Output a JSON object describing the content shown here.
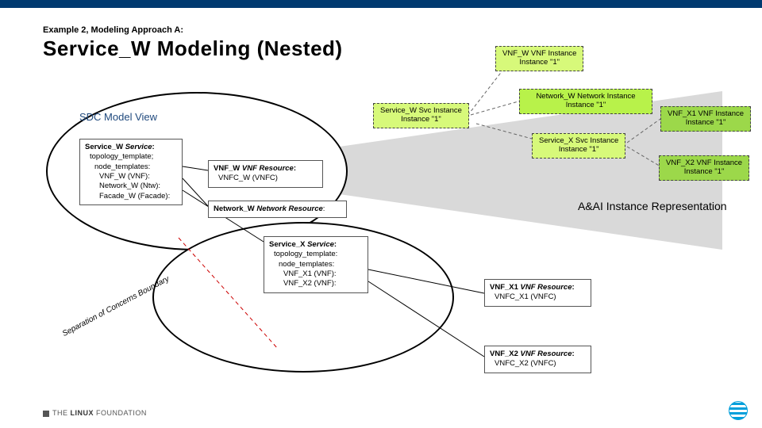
{
  "header": {
    "subtitle": "Example 2, Modeling Approach A:",
    "title": "Service_W Modeling (Nested)"
  },
  "sdc_label": "SDC Model View",
  "service_w": {
    "hdr_pre": "Service_W ",
    "hdr_ital": "Service",
    "l1": "topology_template;",
    "l2": "node_templates:",
    "l3": "VNF_W (VNF):",
    "l4": "Network_W (Ntw):",
    "l5": "Facade_W (Facade):"
  },
  "vnfw_res": {
    "pre": "VNF_W ",
    "ital": "VNF Resource",
    "l1": "VNFC_W (VNFC)"
  },
  "netw_res": {
    "pre": "Network_W ",
    "ital": "Network Resource",
    "suffix": ":"
  },
  "service_x": {
    "hdr_pre": "Service_X ",
    "hdr_ital": "Service",
    "l1": "topology_template:",
    "l2": "node_templates:",
    "l3": "VNF_X1 (VNF):",
    "l4": "VNF_X2 (VNF):"
  },
  "x1_res": {
    "pre": "VNF_X1 ",
    "ital": "VNF Resource",
    "l1": "VNFC_X1 (VNFC)"
  },
  "x2_res": {
    "pre": "VNF_X2 ",
    "ital": "VNF Resource",
    "l1": "VNFC_X2 (VNFC)"
  },
  "instances": {
    "vnfw": {
      "l1": "VNF_W VNF Instance",
      "l2": "Instance \"1\""
    },
    "svcw": {
      "l1": "Service_W Svc Instance",
      "l2": "Instance \"1\""
    },
    "netw": {
      "l1": "Network_W Network Instance",
      "l2": "Instance \"1\""
    },
    "svcx": {
      "l1": "Service_X Svc Instance",
      "l2": "Instance \"1\""
    },
    "x1": {
      "l1": "VNF_X1 VNF Instance",
      "l2": "Instance \"1\""
    },
    "x2": {
      "l1": "VNF_X2 VNF Instance",
      "l2": "Instance \"1\""
    }
  },
  "rep_label": "A&AI Instance Representation",
  "sep_label": "Separation of Concerns Boundary",
  "footer": {
    "text1": "THE",
    "text2": "LINUX",
    "text3": "FOUNDATION"
  }
}
